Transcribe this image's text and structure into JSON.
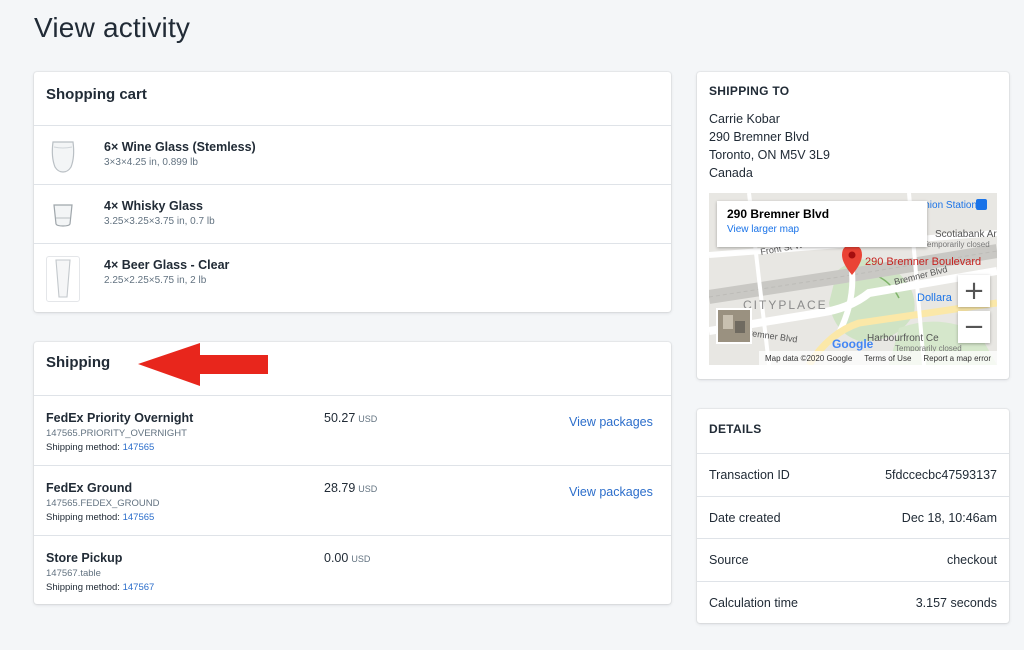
{
  "page": {
    "title": "View activity"
  },
  "cart": {
    "title": "Shopping cart",
    "items": [
      {
        "name": "6× Wine Glass (Stemless)",
        "meta": "3×3×4.25 in, 0.899 lb",
        "icon": "wine-glass-icon"
      },
      {
        "name": "4× Whisky Glass",
        "meta": "3.25×3.25×3.75 in, 0.7 lb",
        "icon": "whisky-glass-icon"
      },
      {
        "name": "4× Beer Glass - Clear",
        "meta": "2.25×2.25×5.75 in, 2 lb",
        "icon": "beer-glass-icon"
      }
    ]
  },
  "shipping": {
    "title": "Shipping",
    "method_prefix": "Shipping method:",
    "rows": [
      {
        "name": "FedEx Priority Overnight",
        "code": "147565.PRIORITY_OVERNIGHT",
        "method_id": "147565",
        "price": "50.27",
        "currency": "USD",
        "action": "View packages"
      },
      {
        "name": "FedEx Ground",
        "code": "147565.FEDEX_GROUND",
        "method_id": "147565",
        "price": "28.79",
        "currency": "USD",
        "action": "View packages"
      },
      {
        "name": "Store Pickup",
        "code": "147567.table",
        "method_id": "147567",
        "price": "0.00",
        "currency": "USD",
        "action": ""
      }
    ]
  },
  "ship_to": {
    "title": "SHIPPING TO",
    "address": [
      "Carrie Kobar",
      "290 Bremner Blvd",
      "Toronto, ON M5V 3L9",
      "Canada"
    ],
    "map": {
      "info_title": "290 Bremner Blvd",
      "info_link": "View larger map",
      "pin_label": "290 Bremner Boulevard",
      "labels": [
        "Union Station",
        "Scotiabank Arena",
        "Temporarily closed",
        "Front St W",
        "Bremner Blvd",
        "CITYPLACE",
        "Dollara",
        "Harbourfront Ce",
        "Temporarily closed",
        "Bremner Blvd"
      ],
      "google": "Google",
      "footer": [
        "Map data ©2020 Google",
        "Terms of Use",
        "Report a map error"
      ],
      "zoom_in": "+",
      "zoom_out": "−"
    }
  },
  "details": {
    "title": "DETAILS",
    "rows": [
      {
        "key": "Transaction ID",
        "value": "5fdccecbc47593137"
      },
      {
        "key": "Date created",
        "value": "Dec 18, 10:46am"
      },
      {
        "key": "Source",
        "value": "checkout"
      },
      {
        "key": "Calculation time",
        "value": "3.157 seconds"
      }
    ]
  },
  "colors": {
    "accent": "#2c6ecb",
    "arrow": "#e8261c",
    "pin": "#ea4335"
  }
}
